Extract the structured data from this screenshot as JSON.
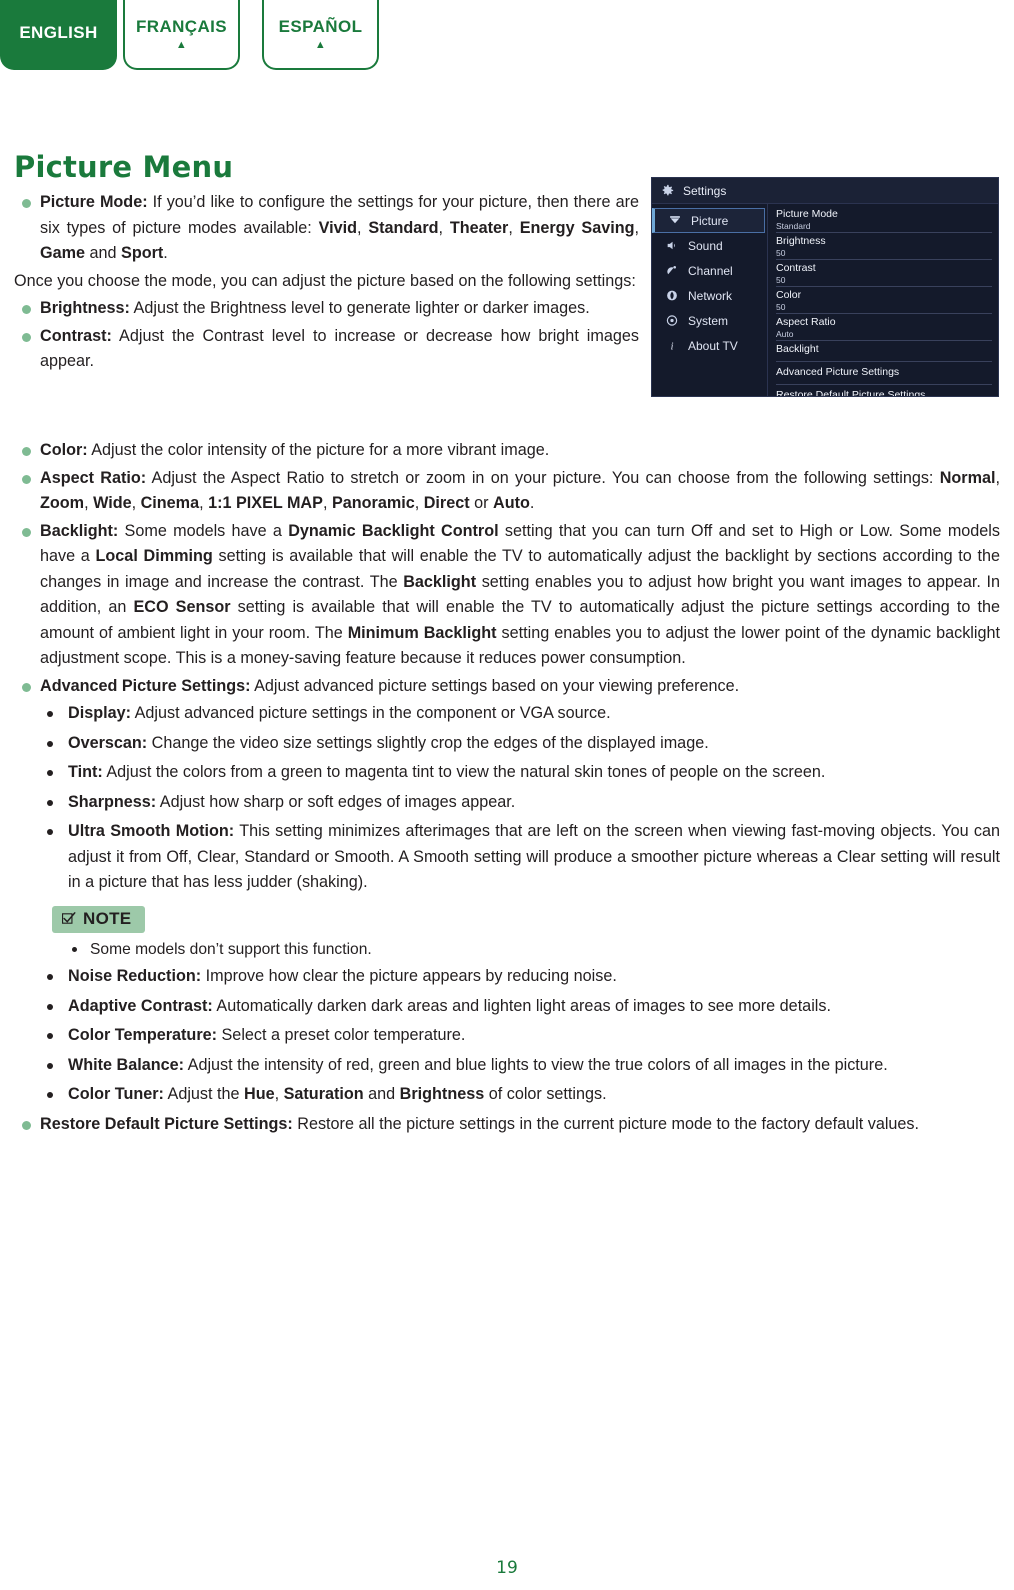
{
  "language_tabs": [
    {
      "label": "ENGLISH",
      "active": true,
      "arrow": ""
    },
    {
      "label": "FRANÇAIS",
      "active": false,
      "arrow": "▲"
    },
    {
      "label": "ESPAÑOL",
      "active": false,
      "arrow": "▲"
    }
  ],
  "page": {
    "title": "Picture Menu",
    "number": "19",
    "accent_color": "#1A7A3C",
    "bullet_color": "#7FBB93",
    "note_badge_color": "#9DC9A9"
  },
  "tv_menu": {
    "title": "Settings",
    "sidebar": [
      {
        "label": "Picture",
        "icon": "picture-icon",
        "selected": true
      },
      {
        "label": "Sound",
        "icon": "speaker-icon",
        "selected": false
      },
      {
        "label": "Channel",
        "icon": "satellite-dish-icon",
        "selected": false
      },
      {
        "label": "Network",
        "icon": "network-globe-icon",
        "selected": false
      },
      {
        "label": "System",
        "icon": "system-gear-icon",
        "selected": false
      },
      {
        "label": "About TV",
        "icon": "info-icon",
        "selected": false
      }
    ],
    "rows": [
      {
        "name": "Picture Mode",
        "value": "Standard"
      },
      {
        "name": "Brightness",
        "value": "50"
      },
      {
        "name": "Contrast",
        "value": "50"
      },
      {
        "name": "Color",
        "value": "50"
      },
      {
        "name": "Aspect Ratio",
        "value": "Auto"
      },
      {
        "name": "Backlight",
        "value": ""
      },
      {
        "name": "Advanced Picture Settings",
        "value": ""
      },
      {
        "name": "Restore Default Picture Settings",
        "value": ""
      }
    ]
  },
  "body": {
    "picture_mode": {
      "term": "Picture Mode:",
      "text_1": " If you’d like to configure the settings for your picture, then there are six types of picture modes available: ",
      "m1": "Vivid",
      "sep1": ", ",
      "m2": "Standard",
      "sep2": ", ",
      "m3": "Theater",
      "sep3": ", ",
      "m4": "Energy Saving",
      "sep4": ", ",
      "m5": "Game",
      "sep5": " and ",
      "m6": "Sport",
      "end": "."
    },
    "once_paragraph": "Once you choose the mode, you can adjust the picture based on the following settings:",
    "brightness": {
      "term": "Brightness:",
      "text": " Adjust the Brightness level to generate lighter or darker images."
    },
    "contrast": {
      "term": "Contrast:",
      "text": " Adjust the Contrast level to increase or decrease how bright images appear."
    },
    "color": {
      "term": "Color:",
      "text": " Adjust the color intensity of the picture for a more vibrant image."
    },
    "aspect_ratio": {
      "term": "Aspect Ratio:",
      "text_1": " Adjust the Aspect Ratio to stretch or zoom in on your picture. You can choose from the following settings: ",
      "o1": "Normal",
      "s1": ", ",
      "o2": "Zoom",
      "s2": ", ",
      "o3": "Wide",
      "s3": ", ",
      "o4": "Cinema",
      "s4": ", ",
      "o5": "1:1 PIXEL MAP",
      "s5": ", ",
      "o6": "Panoramic",
      "s6": ", ",
      "o7": "Direct",
      "s7": " or ",
      "o8": "Auto",
      "end": "."
    },
    "backlight": {
      "term": "Backlight:",
      "t1": " Some models have a ",
      "b1": "Dynamic Backlight Control",
      "t2": " setting that you can turn Off and set to High or Low. Some models have a ",
      "b2": "Local Dimming",
      "t3": " setting is available that will enable the TV to automatically adjust the backlight by sections according to the changes in image and increase the contrast. The ",
      "b3": "Backlight",
      "t4": " setting enables you to adjust how bright you want images to appear. In addition, an ",
      "b4": "ECO Sensor",
      "t5": " setting is available that will enable the TV to automatically adjust the picture settings according to the amount of ambient light in your room. The ",
      "b5": "Minimum Backlight",
      "t6": " setting enables you to adjust the lower point of the dynamic backlight adjustment scope. This is a money-saving feature because it reduces power consumption."
    },
    "advanced_picture_settings": {
      "term": "Advanced Picture Settings:",
      "text": " Adjust advanced picture settings based on your viewing preference."
    },
    "display": {
      "term": "Display:",
      "text": " Adjust advanced picture settings in the component or VGA source."
    },
    "overscan": {
      "term": "Overscan:",
      "text": " Change the video size settings slightly crop the edges of the displayed image."
    },
    "tint": {
      "term": "Tint:",
      "text": " Adjust the colors from a green to magenta tint to view the natural skin tones of people on the screen."
    },
    "sharpness": {
      "term": "Sharpness:",
      "text": " Adjust how sharp or soft edges of images appear."
    },
    "ultra_smooth_motion": {
      "term": "Ultra Smooth Motion:",
      "text": " This setting minimizes afterimages that are left on the screen when viewing fast-moving objects. You can adjust it from Off, Clear, Standard or Smooth. A Smooth setting will produce a smoother picture whereas a Clear setting will result in a picture that has less judder (shaking)."
    },
    "note": {
      "label": "NOTE",
      "item": "Some models don’t support this function."
    },
    "noise_reduction": {
      "term": "Noise Reduction:",
      "text": " Improve how clear the picture appears by reducing noise."
    },
    "adaptive_contrast": {
      "term": "Adaptive Contrast:",
      "text": " Automatically darken dark areas and lighten light areas of images to see more details."
    },
    "color_temperature": {
      "term": "Color Temperature:",
      "text": " Select a preset color temperature."
    },
    "white_balance": {
      "term": "White Balance:",
      "text": " Adjust the intensity of red, green and blue lights to view the true colors of all images in the picture."
    },
    "color_tuner": {
      "term": "Color Tuner:",
      "t1": " Adjust the ",
      "b1": "Hue",
      "s1": ", ",
      "b2": "Saturation",
      "s2": " and ",
      "b3": "Brightness",
      "t2": " of color settings."
    },
    "restore_default": {
      "term": "Restore Default Picture Settings:",
      "text": " Restore all the picture settings in the current picture mode to the factory default values."
    }
  }
}
